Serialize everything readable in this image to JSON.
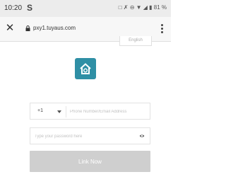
{
  "status_bar": {
    "time": "10:20",
    "carrier_letter": "S",
    "icons_text": "□ ✗ ⊖ ▼ ◢ ▮ 81 %"
  },
  "browser": {
    "url": "pxy1.tuyaus.com",
    "close_icon": "close-icon",
    "lock_icon": "lock-icon",
    "menu_icon": "overflow-menu-icon"
  },
  "page": {
    "language_label": "English",
    "logo_icon": "home-logo-icon",
    "logo_color": "#2f8fa5",
    "country_code": "+1",
    "phone_placeholder": "Phone Number/Email Address",
    "password_placeholder": "Type your password here",
    "link_button_label": "Link Now",
    "button_color": "#cfcfcf"
  }
}
